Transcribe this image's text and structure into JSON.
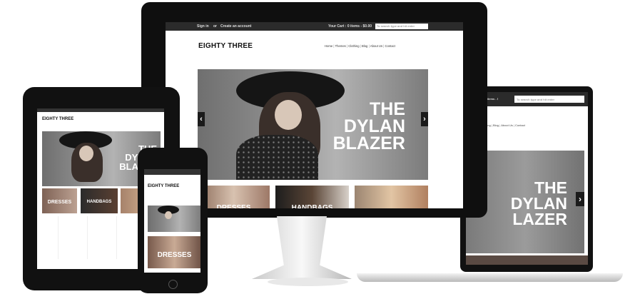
{
  "brand": "EIGHTY THREE",
  "topbar": {
    "signin": "Sign in",
    "or": "or",
    "create": "Create an account",
    "cart": "Your Cart : 0 items - $0.00",
    "search_placeholder": "To search type and hit enter"
  },
  "nav": [
    "Home",
    "Themes",
    "Clothing",
    "Blog",
    "About Us",
    "Contact"
  ],
  "hero": {
    "line1": "THE",
    "line2": "DYLAN",
    "line3": "BLAZER",
    "tablet_line2": "DYLAN",
    "tablet_line3": "BLAZER",
    "laptop_line2": "DYLAN",
    "laptop_line3": "LAZER"
  },
  "categories": {
    "dresses": "DRESSES",
    "handbags": "HANDBAGS"
  },
  "arrows": {
    "left": "‹",
    "right": "›"
  },
  "colors": {
    "device": "#111111",
    "screen": "#ffffff",
    "dark": "#222222"
  }
}
